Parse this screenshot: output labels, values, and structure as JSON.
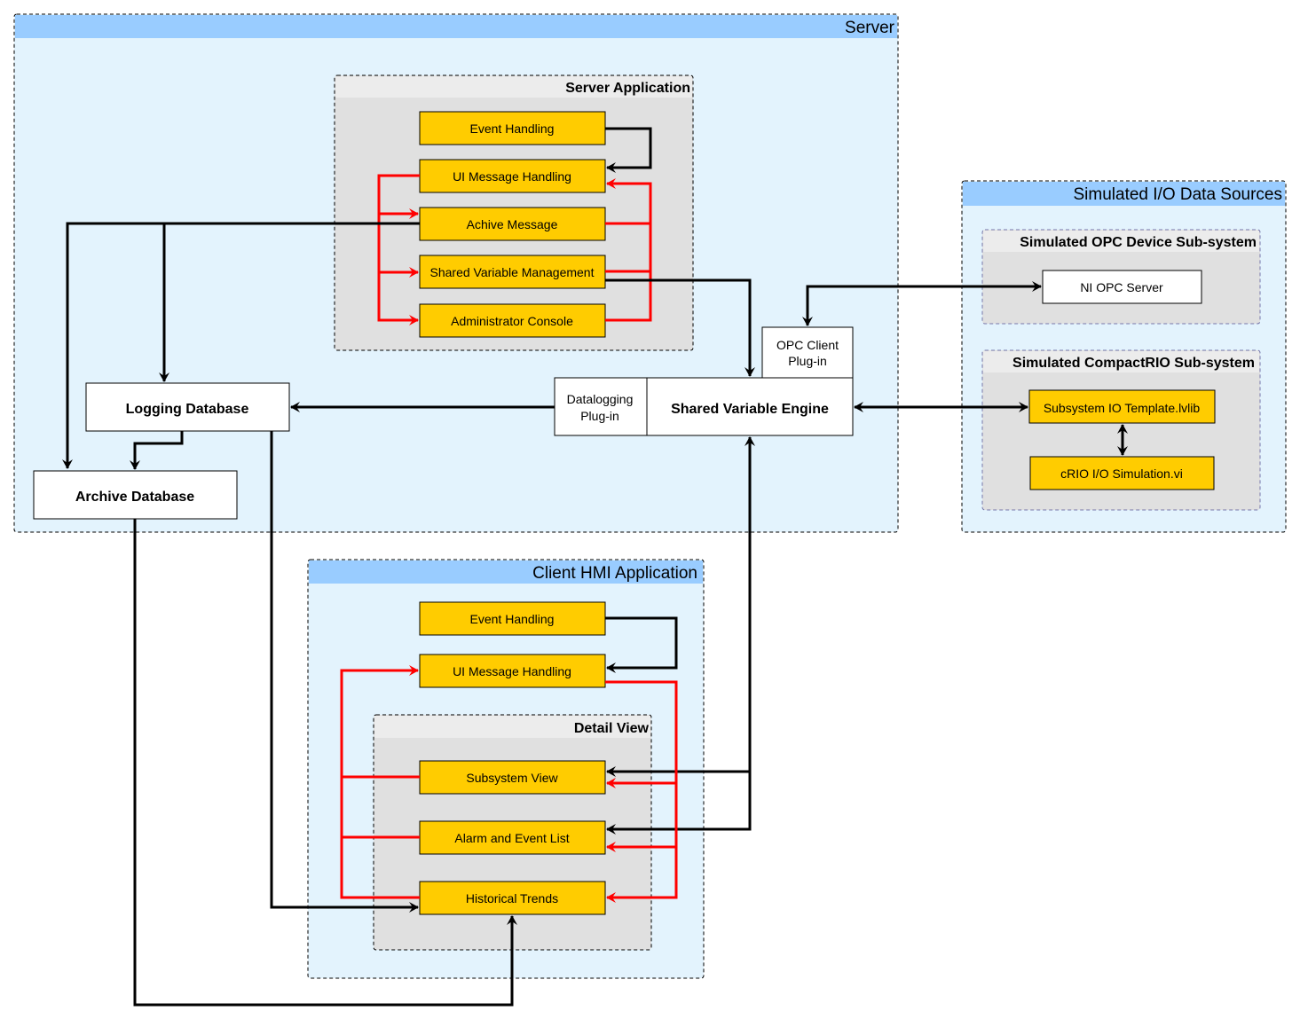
{
  "colors": {
    "container_header": "#99ccff",
    "container_body": "#e3f3fd",
    "subgroup_header": "#ececec",
    "subgroup_body": "#e0e0e0",
    "module_fill": "#ffcc00",
    "control_flow": "#000000",
    "message_flow": "#ff0000"
  },
  "server": {
    "title": "Server",
    "server_application": {
      "title": "Server Application",
      "modules": [
        "Event Handling",
        "UI Message Handling",
        "Achive Message",
        "Shared Variable Management",
        "Administrator Console"
      ]
    },
    "logging_database": "Logging Database",
    "archive_database": "Archive Database",
    "datalogging_plugin": [
      "Datalogging",
      "Plug-in"
    ],
    "opc_client_plugin": [
      "OPC Client",
      "Plug-in"
    ],
    "shared_variable_engine": "Shared Variable Engine"
  },
  "io_sources": {
    "title": "Simulated I/O Data Sources",
    "opc_subsystem": {
      "title": "Simulated OPC Device Sub-system",
      "server": "NI OPC Server"
    },
    "crio_subsystem": {
      "title": "Simulated CompactRIO Sub-system",
      "template": "Subsystem IO Template.lvlib",
      "simulation": "cRIO I/O Simulation.vi"
    }
  },
  "client": {
    "title": "Client HMI Application",
    "modules": [
      "Event Handling",
      "UI Message Handling"
    ],
    "detail_view": {
      "title": "Detail View",
      "modules": [
        "Subsystem View",
        "Alarm and Event List",
        "Historical Trends"
      ]
    }
  }
}
